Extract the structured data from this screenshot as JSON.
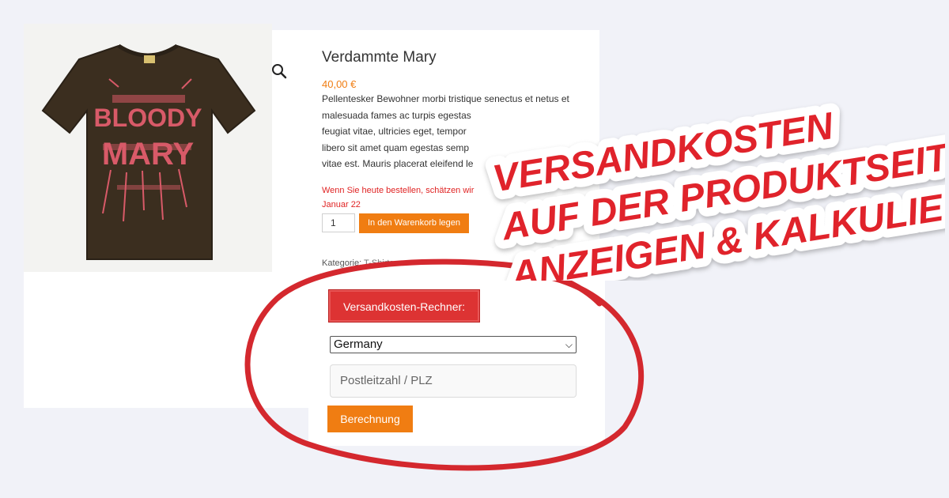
{
  "product": {
    "title": "Verdammte Mary",
    "price": "40,00 €",
    "description_lines": [
      "Pellentesker Bewohner morbi tristique senectus et netus et",
      "malesuada fames ac turpis egestas",
      "feugiat vitae, ultricies eget, tempor",
      "libero sit amet quam egestas semp",
      "vitae est. Mauris placerat eleifend le"
    ],
    "delivery_line1": "Wenn Sie heute bestellen, schätzen wir",
    "delivery_line2": "Januar 22",
    "quantity": "1",
    "add_to_cart_label": "In den Warenkorb legen",
    "category_label": "Kategorie:",
    "category_value": "T-Shirts",
    "shirt_print": "BLOODY MARY"
  },
  "calculator": {
    "heading": "Versandkosten-Rechner:",
    "country_selected": "Germany",
    "zip_placeholder": "Postleitzahl / PLZ",
    "submit_label": "Berechnung"
  },
  "headline": {
    "line1": "VERSANDKOSTEN",
    "line2": "AUF DER PRODUKTSEITE",
    "line3": "ANZEIGEN & KALKULIEREN"
  },
  "colors": {
    "accent_orange": "#f07d12",
    "accent_red": "#dd3333",
    "background": "#f1f2f8"
  },
  "icons": {
    "zoom": "magnifier-icon",
    "select": "chevron-down-icon"
  }
}
